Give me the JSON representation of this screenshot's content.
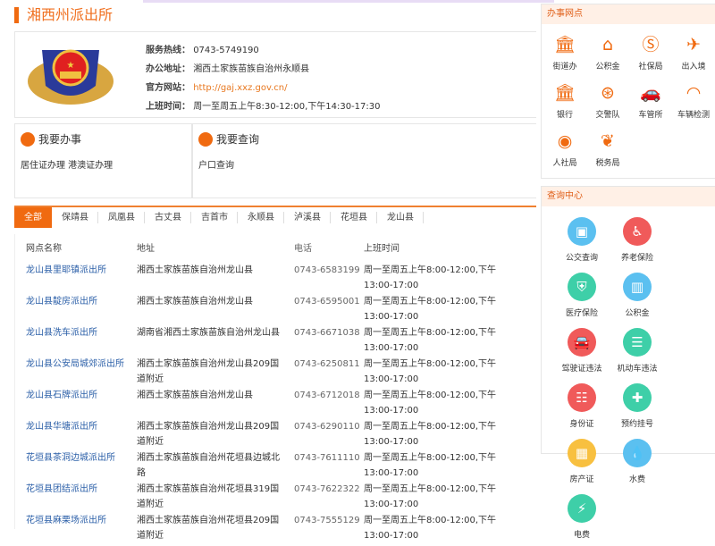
{
  "title": "湘西州派出所",
  "info": {
    "hotline_label": "服务热线：",
    "hotline": "0743-5749190",
    "address_label": "办公地址：",
    "address": "湘西土家族苗族自治州永顺县",
    "website_label": "官方网站：",
    "website": "http://gaj.xxz.gov.cn/",
    "hours_label": "上班时间：",
    "hours": "周一至周五上午8:30-12:00,下午14:30-17:30"
  },
  "panels": {
    "do": {
      "title": "我要办事",
      "text": "居住证办理  港澳证办理"
    },
    "query": {
      "title": "我要查询",
      "text": "户口查询"
    }
  },
  "tabs": [
    "全部",
    "保靖县",
    "凤凰县",
    "古丈县",
    "吉首市",
    "永顺县",
    "泸溪县",
    "花垣县",
    "龙山县"
  ],
  "table": {
    "headers": [
      "网点名称",
      "地址",
      "电话",
      "上班时间"
    ],
    "rows": [
      [
        "龙山县里耶镇派出所",
        "湘西土家族苗族自治州龙山县",
        "0743-6583199",
        "周一至周五上午8:00-12:00,下午13:00-17:00"
      ],
      [
        "龙山县靛房派出所",
        "湘西土家族苗族自治州龙山县",
        "0743-6595001",
        "周一至周五上午8:00-12:00,下午13:00-17:00"
      ],
      [
        "龙山县洗车派出所",
        "湖南省湘西土家族苗族自治州龙山县",
        "0743-6671038",
        "周一至周五上午8:00-12:00,下午13:00-17:00"
      ],
      [
        "龙山县公安局城郊派出所",
        "湘西土家族苗族自治州龙山县209国道附近",
        "0743-6250811",
        "周一至周五上午8:00-12:00,下午13:00-17:00"
      ],
      [
        "龙山县石牌派出所",
        "湘西土家族苗族自治州龙山县",
        "0743-6712018",
        "周一至周五上午8:00-12:00,下午13:00-17:00"
      ],
      [
        "龙山县华塘派出所",
        "湘西土家族苗族自治州龙山县209国道附近",
        "0743-6290110",
        "周一至周五上午8:00-12:00,下午13:00-17:00"
      ],
      [
        "花垣县茶洞边城派出所",
        "湘西土家族苗族自治州花垣县边城北路",
        "0743-7611110",
        "周一至周五上午8:00-12:00,下午13:00-17:00"
      ],
      [
        "花垣县团结派出所",
        "湘西土家族苗族自治州花垣县319国道附近",
        "0743-7622322",
        "周一至周五上午8:00-12:00,下午13:00-17:00"
      ],
      [
        "花垣县麻栗场派出所",
        "湘西土家族苗族自治州花垣县209国道附近",
        "0743-7555129",
        "周一至周五上午8:00-12:00,下午13:00-17:00"
      ]
    ]
  },
  "offices": {
    "title": "办事网点",
    "items": [
      {
        "label": "街道办",
        "icon": "bank-icon",
        "glyph": "🏛"
      },
      {
        "label": "公积金",
        "icon": "house-icon",
        "glyph": "⌂"
      },
      {
        "label": "社保局",
        "icon": "social-security-icon",
        "glyph": "Ⓢ"
      },
      {
        "label": "出入境",
        "icon": "immigration-icon",
        "glyph": "✈"
      },
      {
        "label": "银行",
        "icon": "bank-icon",
        "glyph": "🏛"
      },
      {
        "label": "交警队",
        "icon": "steering-wheel-icon",
        "glyph": "⊛"
      },
      {
        "label": "车管所",
        "icon": "car-icon",
        "glyph": "🚗"
      },
      {
        "label": "车辆检测",
        "icon": "gauge-icon",
        "glyph": "◠"
      },
      {
        "label": "人社局",
        "icon": "hr-bureau-icon",
        "glyph": "◉"
      },
      {
        "label": "税务局",
        "icon": "tax-icon",
        "glyph": "❦"
      }
    ]
  },
  "query_center": {
    "title": "查询中心",
    "items": [
      {
        "label": "公交查询",
        "icon": "bus-icon",
        "color": "#5bc0f0",
        "glyph": "▣"
      },
      {
        "label": "养老保险",
        "icon": "elderly-icon",
        "color": "#f05a5a",
        "glyph": "♿"
      },
      {
        "label": "医疗保险",
        "icon": "shield-icon",
        "color": "#3ecfa8",
        "glyph": "⛨"
      },
      {
        "label": "公积金",
        "icon": "chart-icon",
        "color": "#5bc0f0",
        "glyph": "▥"
      },
      {
        "label": "驾驶证违法",
        "icon": "car-icon",
        "color": "#f05a5a",
        "glyph": "🚘"
      },
      {
        "label": "机动车违法",
        "icon": "card-stack-icon",
        "color": "#3ecfa8",
        "glyph": "☰"
      },
      {
        "label": "身份证",
        "icon": "id-card-icon",
        "color": "#f05a5a",
        "glyph": "☷"
      },
      {
        "label": "预约挂号",
        "icon": "medical-cross-icon",
        "color": "#3ecfa8",
        "glyph": "✚"
      },
      {
        "label": "房产证",
        "icon": "building-icon",
        "color": "#f8c040",
        "glyph": "▦"
      },
      {
        "label": "水费",
        "icon": "water-drop-icon",
        "color": "#5bc0f0",
        "glyph": "💧"
      },
      {
        "label": "电费",
        "icon": "electricity-icon",
        "color": "#3ecfa8",
        "glyph": "⚡"
      }
    ]
  }
}
